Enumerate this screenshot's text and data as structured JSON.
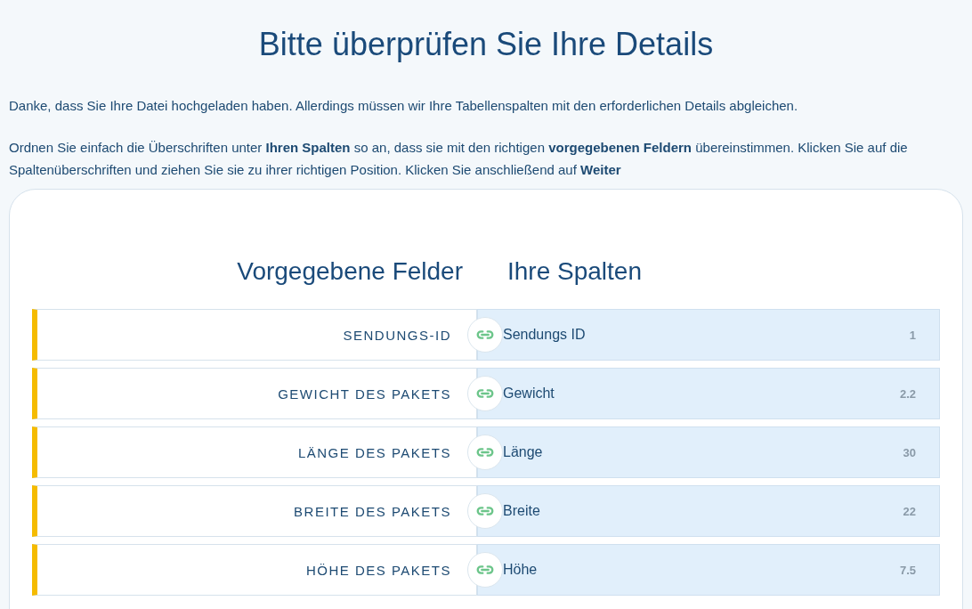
{
  "title": "Bitte überprüfen Sie Ihre Details",
  "intro": [
    "Danke, dass Sie Ihre Datei hochgeladen haben. Allerdings müssen wir Ihre Tabellenspalten mit den erforderlichen Details abgleichen.",
    "Ordnen Sie einfach die Überschriften unter **Ihren Spalten** so an, dass sie mit den richtigen **vorgegebenen Feldern** übereinstimmen. Klicken Sie auf die Spaltenüberschriften und ziehen Sie sie zu ihrer richtigen Position. Klicken Sie anschließend auf **Weiter**"
  ],
  "mapping": {
    "left_heading": "Vorgegebene Felder",
    "right_heading": "Ihre Spalten",
    "rows": [
      {
        "field": "SENDUNGS-ID",
        "column": "Sendungs ID",
        "sample": "1"
      },
      {
        "field": "GEWICHT DES PAKETS",
        "column": "Gewicht",
        "sample": "2.2"
      },
      {
        "field": "LÄNGE DES PAKETS",
        "column": "Länge",
        "sample": "30"
      },
      {
        "field": "BREITE DES PAKETS",
        "column": "Breite",
        "sample": "22"
      },
      {
        "field": "HÖHE DES PAKETS",
        "column": "Höhe",
        "sample": "7.5"
      }
    ]
  }
}
